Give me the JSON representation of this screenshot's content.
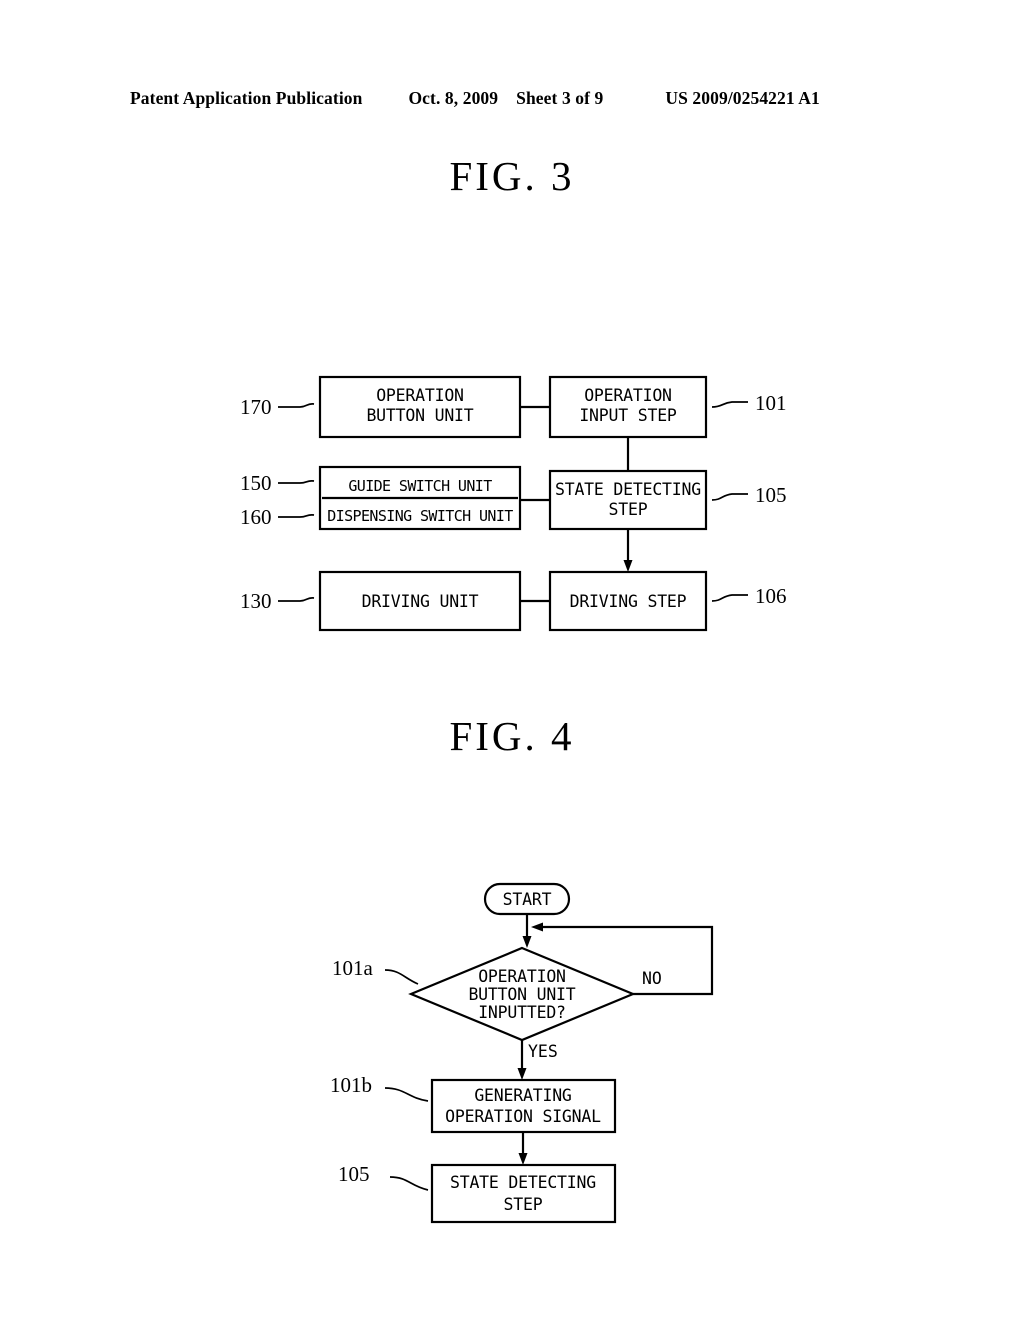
{
  "header": {
    "publication": "Patent Application Publication",
    "date": "Oct. 8, 2009",
    "sheet": "Sheet 3 of 9",
    "document_number": "US 2009/0254221 A1"
  },
  "figures": [
    {
      "title": "FIG.  3",
      "type": "block-diagram",
      "nodes": [
        {
          "id": "operation-button-unit",
          "ref": "170",
          "ref_side": "left",
          "lines": [
            "OPERATION",
            "BUTTON UNIT"
          ]
        },
        {
          "id": "operation-input-step",
          "ref": "101",
          "ref_side": "right",
          "lines": [
            "OPERATION",
            "INPUT STEP"
          ]
        },
        {
          "id": "guide-switch-unit",
          "ref": "150",
          "ref_side": "left",
          "lines": [
            "GUIDE SWITCH UNIT"
          ]
        },
        {
          "id": "dispensing-switch-unit",
          "ref": "160",
          "ref_side": "left",
          "lines": [
            "DISPENSING SWITCH UNIT"
          ]
        },
        {
          "id": "state-detecting-step",
          "ref": "105",
          "ref_side": "right",
          "lines": [
            "STATE DETECTING",
            "STEP"
          ]
        },
        {
          "id": "driving-unit",
          "ref": "130",
          "ref_side": "left",
          "lines": [
            "DRIVING UNIT"
          ]
        },
        {
          "id": "driving-step",
          "ref": "106",
          "ref_side": "right",
          "lines": [
            "DRIVING STEP"
          ]
        }
      ]
    },
    {
      "title": "FIG.  4",
      "type": "flowchart",
      "nodes": [
        {
          "id": "start",
          "shape": "terminator",
          "lines": [
            "START"
          ]
        },
        {
          "id": "operation-button-decision",
          "shape": "decision",
          "ref": "101a",
          "lines": [
            "OPERATION",
            "BUTTON UNIT",
            "INPUTTED?"
          ]
        },
        {
          "id": "generating-operation-signal",
          "shape": "process",
          "ref": "101b",
          "lines": [
            "GENERATING",
            "OPERATION SIGNAL"
          ]
        },
        {
          "id": "state-detecting-step",
          "shape": "process",
          "ref": "105",
          "lines": [
            "STATE DETECTING",
            "STEP"
          ]
        }
      ],
      "branch_labels": {
        "yes": "YES",
        "no": "NO"
      }
    }
  ]
}
